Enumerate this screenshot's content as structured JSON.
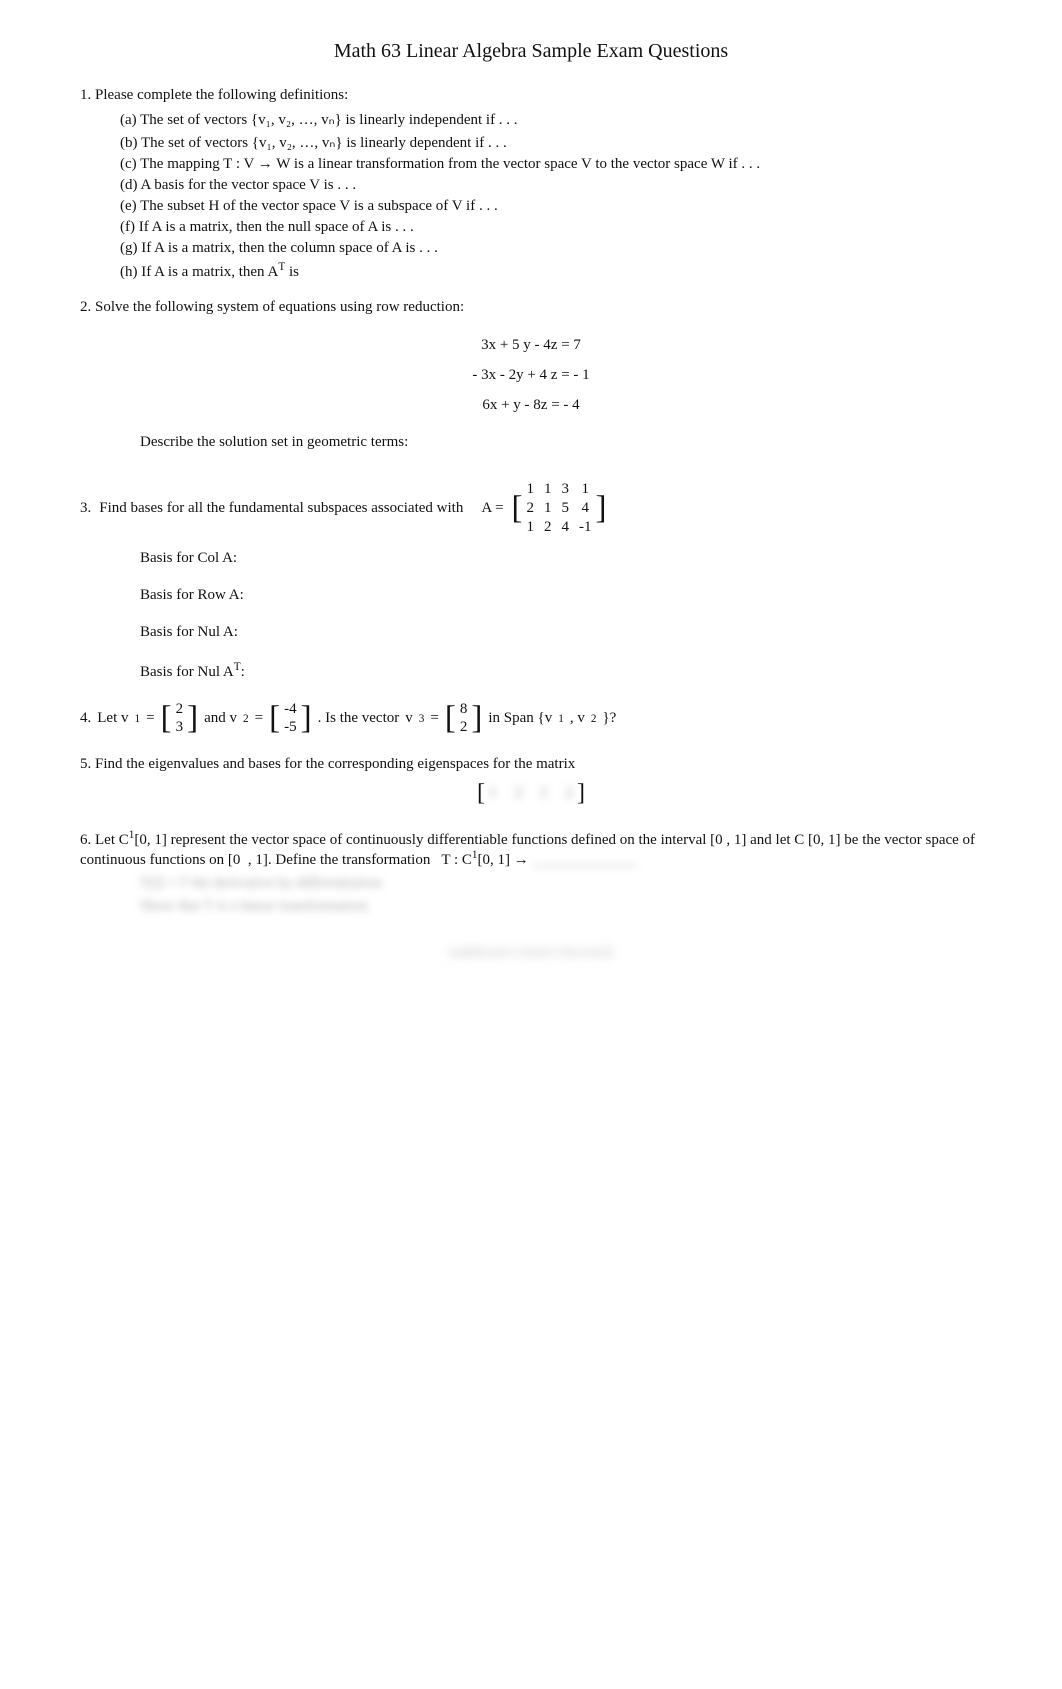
{
  "title": "Math 63 Linear Algebra Sample Exam Questions",
  "questions": [
    {
      "number": "1.",
      "text": "Please complete the following definitions:",
      "subitems": [
        {
          "label": "(a)",
          "text": "The set of vectors   {v₁, v₂, …, vₙ}  is linearly independent   if . . ."
        },
        {
          "label": "(b)",
          "text": "The set of vectors   {v₁, v₂, …, vₙ}  is linearly dependent   if . . ."
        },
        {
          "label": "(c)",
          "text": "The mapping   T : V → W  is a linear transformation   from the vector space   V to the vector space  W if . . ."
        },
        {
          "label": "(d)",
          "text": "A  basis  for the vector space   V is . . ."
        },
        {
          "label": "(e)",
          "text": "The subset   H  of the vector space   V  is a subspace  of V if . . ."
        },
        {
          "label": "(f)",
          "text": "If A is a matrix, then the   null space  of A is . . ."
        },
        {
          "label": "(g)",
          "text": "If A is a matrix, then the   column space  of A is . . ."
        },
        {
          "label": "(h)",
          "text": "If A is a matrix, then  Aᵀ is"
        }
      ]
    },
    {
      "number": "2.",
      "text": "Solve the following system of equations using row reduction:",
      "equations": [
        "3x + 5 y -  4z   =      7",
        "- 3x -  2y + 4 z   =   - 1",
        "6x + y -  8z   =   - 4"
      ],
      "describe_text": "Describe the solution set in geometric terms:"
    },
    {
      "number": "3.",
      "text": "Find bases for all the fundamental subspaces associated with",
      "matrix_label": "A =",
      "matrix_rows": [
        [
          "1",
          "1",
          "3",
          "1"
        ],
        [
          "2",
          "1",
          "5",
          "4"
        ],
        [
          "1",
          "2",
          "4",
          "-1"
        ]
      ],
      "basis_items": [
        "Basis for Col A:",
        "Basis for Row A:",
        "Basis for Nul A:",
        "Basis for Nul Aᵀ:"
      ]
    },
    {
      "number": "4.",
      "prefix": "Let v₁ =",
      "v1": [
        "2",
        "3"
      ],
      "middle": "and  v₂ =",
      "v2": [
        "-4",
        "-5"
      ],
      "suffix": ". Is the vector",
      "v3_label": "v₃ =",
      "v3": [
        "8",
        "2"
      ],
      "question_end": "in Span {v₁, v₂}?"
    },
    {
      "number": "5.",
      "text": "Find the eigenvalues and bases for the corresponding eigenspaces for the matrix"
    },
    {
      "number": "6.",
      "text": "Let C¹[0, 1] represent the vector space of continuously differentiable functions defined on the interval [0 , 1] and let  C [0, 1] be the vector space of continuous functions on [0   , 1]. Define the transformation   T : C¹[0, 1] →"
    }
  ]
}
